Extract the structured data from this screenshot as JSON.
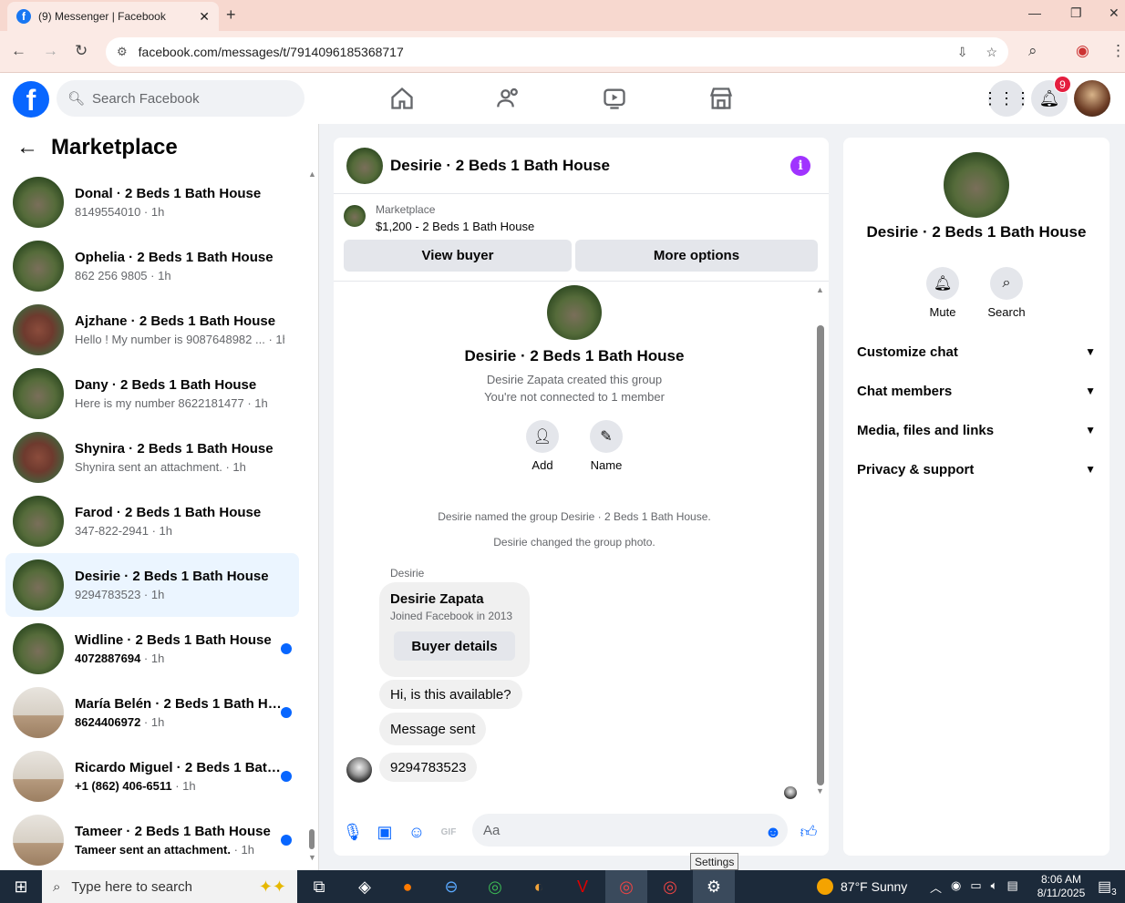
{
  "browser": {
    "tab_title": "(9) Messenger | Facebook",
    "tab_close": "✕",
    "new_tab": "+",
    "url": "facebook.com/messages/t/7914096185368717"
  },
  "fb_header": {
    "logo": "f",
    "search_placeholder": "Search Facebook",
    "notification_count": "9",
    "nav_icons": [
      "home-icon",
      "friends-icon",
      "watch-icon",
      "marketplace-icon"
    ]
  },
  "sidebar": {
    "title": "Marketplace",
    "conversations": [
      {
        "name": "Donal · 2 Beds 1 Bath House",
        "preview": "8149554010",
        "time": " · 1h",
        "unread": false
      },
      {
        "name": "Ophelia · 2 Beds 1 Bath House",
        "preview": "862 256 9805",
        "time": " · 1h",
        "unread": false
      },
      {
        "name": "Ajzhane · 2 Beds 1 Bath House",
        "preview": "Hello ! My number is 9087648982 ...",
        "time": " · 1h",
        "unread": false
      },
      {
        "name": "Dany · 2 Beds 1 Bath House",
        "preview": "Here is my number 8622181477",
        "time": " · 1h",
        "unread": false
      },
      {
        "name": "Shynira · 2 Beds 1 Bath House",
        "preview": "Shynira sent an attachment.",
        "time": " · 1h",
        "unread": false
      },
      {
        "name": "Farod · 2 Beds 1 Bath House",
        "preview": "347-822-2941",
        "time": " · 1h",
        "unread": false
      },
      {
        "name": "Desirie · 2 Beds 1 Bath House",
        "preview": "9294783523",
        "time": " · 1h",
        "unread": false
      },
      {
        "name": "Widline · 2 Beds 1 Bath House",
        "preview": "4072887694",
        "time": " · 1h",
        "unread": true
      },
      {
        "name": "María Belén · 2 Beds 1 Bath Ho...",
        "preview": "8624406972",
        "time": " · 1h",
        "unread": true
      },
      {
        "name": "Ricardo Miguel · 2 Beds 1 Bath...",
        "preview": "+1 (862) 406-6511",
        "time": " · 1h",
        "unread": true
      },
      {
        "name": "Tameer · 2 Beds 1 Bath House",
        "preview": "Tameer sent an attachment.",
        "time": " · 1h",
        "unread": true
      }
    ]
  },
  "chat": {
    "title": "Desirie · 2 Beds 1 Bath House",
    "info_icon": "i",
    "marketplace_label": "Marketplace",
    "listing": "$1,200 - 2 Beds 1 Bath House",
    "view_buyer": "View buyer",
    "more_options": "More options",
    "group_name": "Desirie · 2 Beds 1 Bath House",
    "created_by": "Desirie Zapata created this group",
    "connection": "You're not connected to 1 member",
    "add_label": "Add",
    "name_label": "Name",
    "system_messages": [
      "Desirie named the group Desirie · 2 Beds 1 Bath House.",
      "Desirie changed the group photo."
    ],
    "sender": "Desirie",
    "card_name": "Desirie Zapata",
    "card_joined": "Joined Facebook in 2013",
    "card_button": "Buyer details",
    "messages": [
      "Hi, is this available?",
      "Message sent",
      "9294783523"
    ],
    "composer_placeholder": "Aa"
  },
  "info_panel": {
    "title": "Desirie · 2 Beds 1 Bath House",
    "mute": "Mute",
    "search": "Search",
    "sections": [
      "Customize chat",
      "Chat members",
      "Media, files and links",
      "Privacy & support"
    ]
  },
  "tooltip": "Settings",
  "taskbar": {
    "search_placeholder": "Type here to search",
    "weather": "87°F  Sunny",
    "time": "8:06 AM",
    "date": "8/11/2025",
    "notif_count": "3"
  }
}
